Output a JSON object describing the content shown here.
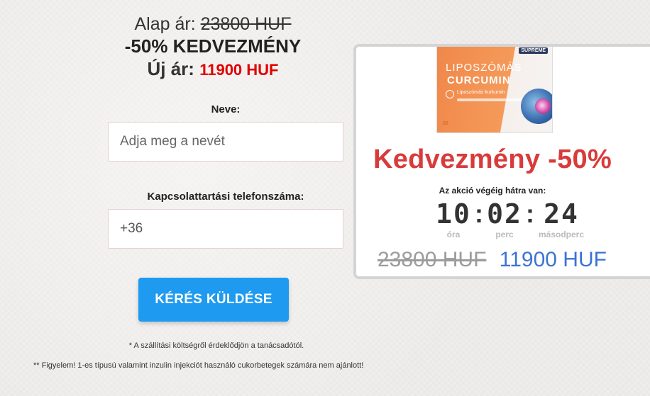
{
  "pricing": {
    "base_label": "Alap ár:",
    "base_value": "23800 HUF",
    "discount_text": "-50% KEDVEZMÉNY",
    "new_label": "Új ár:",
    "new_value": "11900 HUF"
  },
  "form": {
    "name_label": "Neve:",
    "name_placeholder": "Adja meg a nevét",
    "name_value": "",
    "phone_label": "Kapcsolattartási telefonszáma:",
    "phone_value": "+36",
    "submit_label": "KÉRÉS KÜLDÉSE",
    "shipping_note": "* A szállítási költségről érdeklődjön a tanácsadótól.",
    "warning_note": "** Figyelem! 1-es típusú valamint inzulin injekciót használó cukorbetegek számára nem ajánlott!"
  },
  "promo": {
    "product": {
      "brand": "SUPREME",
      "name_line1": "LIPOSZÓMÁS",
      "name_line2": "CURCUMIN",
      "subtitle": "Liposzómás kurkumin",
      "count": "30"
    },
    "title": "Kedvezmény -50%",
    "countdown_label": "Az akció végéig hátra van:",
    "timer": {
      "hours": "10",
      "minutes": "02",
      "seconds": "24",
      "hours_unit": "óra",
      "minutes_unit": "perc",
      "seconds_unit": "másodperc"
    },
    "old_price": "23800 HUF",
    "new_price": "11900 HUF"
  },
  "colors": {
    "accent_red": "#e00000",
    "promo_red": "#d93b3b",
    "button_blue": "#1e9af0",
    "new_price_blue": "#3b73d6",
    "product_orange": "#f0884a"
  }
}
